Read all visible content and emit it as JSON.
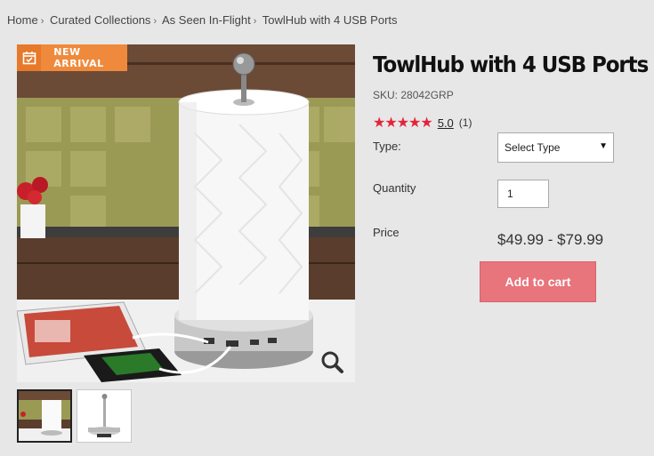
{
  "breadcrumb": {
    "items": [
      "Home",
      "Curated Collections",
      "As Seen In-Flight",
      "TowlHub with 4 USB Ports"
    ],
    "separator": "›"
  },
  "badge": {
    "label": "NEW ARRIVAL",
    "color": "#ef8a3c",
    "icon": "calendar-check-icon"
  },
  "product": {
    "title": "TowlHub with 4 USB Ports",
    "sku": "SKU: 28042GRP",
    "rating": {
      "stars": "★★★★★",
      "score": "5.0",
      "count": "(1)",
      "value": 5,
      "max": 5,
      "star_color": "#e4243a"
    },
    "type_label": "Type:",
    "type_select": {
      "selected": "Select Type"
    },
    "quantity_label": "Quantity",
    "quantity_value": "1",
    "price_label": "Price",
    "price": "$49.99 - $79.99",
    "add_to_cart": "Add to cart"
  },
  "colors": {
    "button": "#e8747c",
    "background": "#e7e7e7"
  },
  "icons": {
    "zoom": "magnifier-icon",
    "select": "dropdown-arrow-icon"
  }
}
